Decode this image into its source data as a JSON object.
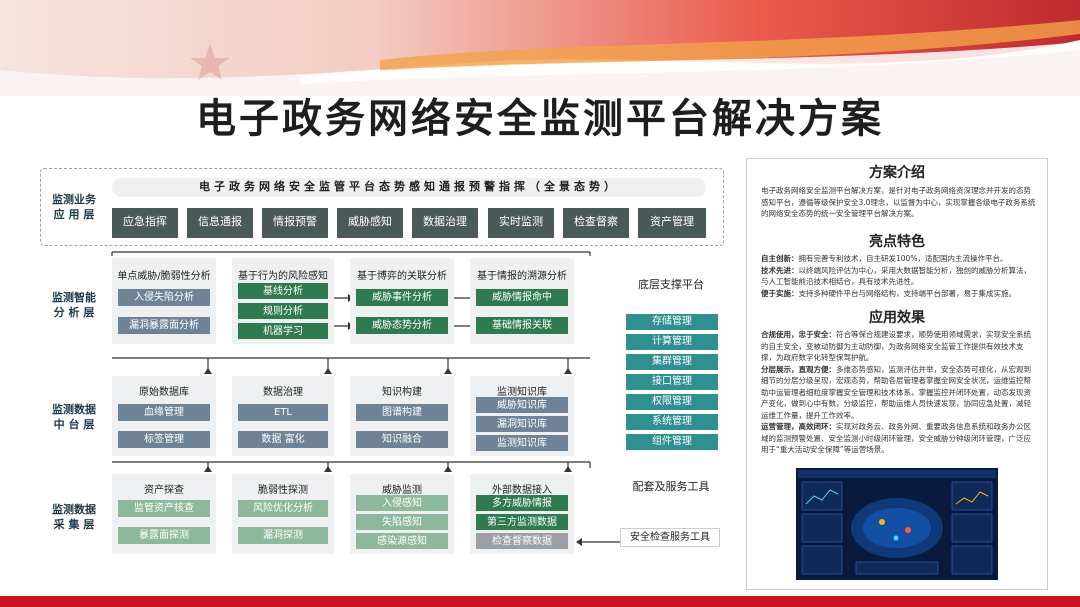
{
  "title": "电子政务网络安全监测平台解决方案",
  "layers": {
    "business": "监测业务\n应 用 层",
    "analysis": "监测智能\n分 析 层",
    "datamid": "监测数据\n中 台 层",
    "collect": "监测数据\n采 集 层"
  },
  "business": {
    "banner": "电子政务网络安全监管平台态势感知通报预警指挥（全景态势）",
    "tiles": [
      "应急指挥",
      "信息通报",
      "情报预警",
      "威胁感知",
      "数据治理",
      "实时监测",
      "检查督察",
      "资产管理"
    ]
  },
  "analysis": {
    "cols": [
      {
        "header": "单点威胁/脆弱性分析",
        "items": [
          "入侵失陷分析",
          "漏洞暴露面分析"
        ]
      },
      {
        "header": "基于行为的风险感知",
        "items": [
          "基线分析",
          "规则分析",
          "机器学习"
        ]
      },
      {
        "header": "基于博弈的关联分析",
        "items": [
          "威胁事件分析",
          "威胁态势分析"
        ]
      },
      {
        "header": "基于情报的溯源分析",
        "items": [
          "威胁情报命中",
          "基础情报关联"
        ]
      }
    ]
  },
  "datamid": {
    "cols": [
      {
        "header": "原始数据库",
        "items": [
          "血缘管理",
          "标签管理"
        ]
      },
      {
        "header": "数据治理",
        "items": [
          "ETL",
          "数据 富化"
        ]
      },
      {
        "header": "知识构建",
        "items": [
          "图谱构建",
          "知识融合"
        ]
      },
      {
        "header": "监测知识库",
        "items": [
          "威胁知识库",
          "漏洞知识库",
          "监测知识库"
        ]
      }
    ]
  },
  "collect": {
    "cols": [
      {
        "header": "资产探查",
        "items": [
          "监管资产核查",
          "暴露面探测"
        ]
      },
      {
        "header": "脆弱性探测",
        "items": [
          "风险优化分析",
          "漏洞探测"
        ]
      },
      {
        "header": "威胁监测",
        "items": [
          "入侵感知",
          "失陷感知",
          "感染源感知"
        ]
      },
      {
        "header": "外部数据接入",
        "items": [
          "多方威胁情报",
          "第三方监测数据",
          "检查督察数据"
        ]
      }
    ]
  },
  "platform": {
    "title": "底层支撑平台",
    "items": [
      "存储管理",
      "计算管理",
      "集群管理",
      "接口管理",
      "权限管理",
      "系统管理",
      "组件管理"
    ]
  },
  "tools": {
    "title": "配套及服务工具",
    "item": "安全检查服务工具"
  },
  "right_panel": {
    "intro_title": "方案介绍",
    "intro_text": "电子政务网络安全监测平台解决方案，是针对电子政务网络资深理念并开发的态势感知平台，遵循等级保护安全3.0理念，以监督为中心，实现掌握各级电子政务系统的网络安全态势的统一安全管理平台解决方案。",
    "features_title": "亮点特色",
    "features": [
      {
        "k": "自主创新：",
        "v": "拥有完善专利技术，自主研发100%，适配国内主流操作平台。"
      },
      {
        "k": "技术先进：",
        "v": "以终端风险评估为中心，采用大数据智能分析，独创的威胁分析算法，与人工智能前沿技术相结合，具有技术先进性。"
      },
      {
        "k": "便于实施：",
        "v": "支持多种硬件平台与网络结构，支持端平台部署，易于集成实施。"
      }
    ],
    "effects_title": "应用效果",
    "effects": [
      {
        "k": "合规使用，忠于安全：",
        "v": "符合等保合规建设要求，顺势使用领域需求，实现安全系统的自主安全，变被动防御为主动防御，为政务网络安全监管工作提供有效技术支撑，为政府数字化转型保驾护航。"
      },
      {
        "k": "分层展示，直观方便：",
        "v": "多维态势感知，监测评估并举，安全态势可视化，从宏观到细节的分层分级呈现，宏观态势，帮助各层管理者掌握全网安全状况，运维监控帮助中运管理者细粒度掌握安全管理和技术体系，掌握监控并闭环处置，动态发现资产变化，做到心中有数，分级监控，帮助运维人员快速发现，协同应急处置，减轻运维工作量，提升工作效率。"
      },
      {
        "k": "运营管理，高效闭环：",
        "v": "实现对政务云、政务外网、重要政务信息系统和政务办公区域的监测预警处置、安全监测小时级闭环管理，安全威胁分钟级闭环管理，广泛应用于“重大活动安全保障”等运营场景。"
      }
    ]
  }
}
